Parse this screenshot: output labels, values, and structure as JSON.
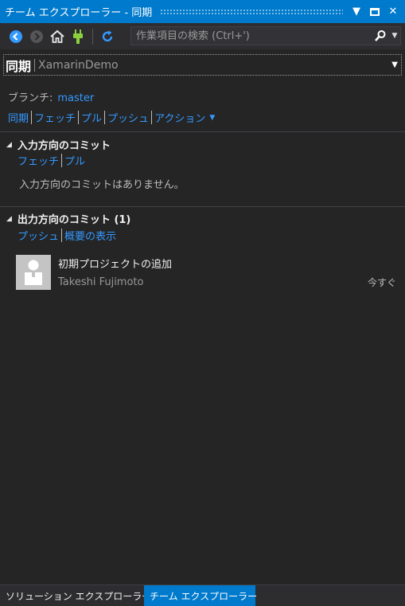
{
  "window": {
    "title": "チーム エクスプローラー - 同期",
    "icons": [
      "dropdown-icon",
      "maximize-icon",
      "close-icon"
    ]
  },
  "toolbar": {
    "icons": [
      "back-icon",
      "forward-icon",
      "home-icon",
      "connect-icon",
      "refresh-icon"
    ],
    "search_placeholder": "作業項目の検索 (Ctrl+')"
  },
  "page": {
    "title": "同期",
    "repo": "XamarinDemo"
  },
  "branch": {
    "label": "ブランチ:",
    "value": "master"
  },
  "actions": [
    "同期",
    "フェッチ",
    "プル",
    "プッシュ",
    "アクション"
  ],
  "incoming": {
    "title": "入力方向のコミット",
    "links": [
      "フェッチ",
      "プル"
    ],
    "empty_message": "入力方向のコミットはありません。"
  },
  "outgoing": {
    "title": "出力方向のコミット (1)",
    "links": [
      "プッシュ",
      "概要の表示"
    ],
    "commits": [
      {
        "message": "初期プロジェクトの追加",
        "author": "Takeshi Fujimoto",
        "time": "今すぐ"
      }
    ]
  },
  "bottom_tabs": [
    {
      "label": "ソリューション エクスプローラー",
      "active": false
    },
    {
      "label": "チーム エクスプローラー",
      "active": true
    }
  ],
  "colors": {
    "accent": "#007acc",
    "link": "#3399ff",
    "background": "#252526",
    "toolbar": "#2d2d30"
  }
}
